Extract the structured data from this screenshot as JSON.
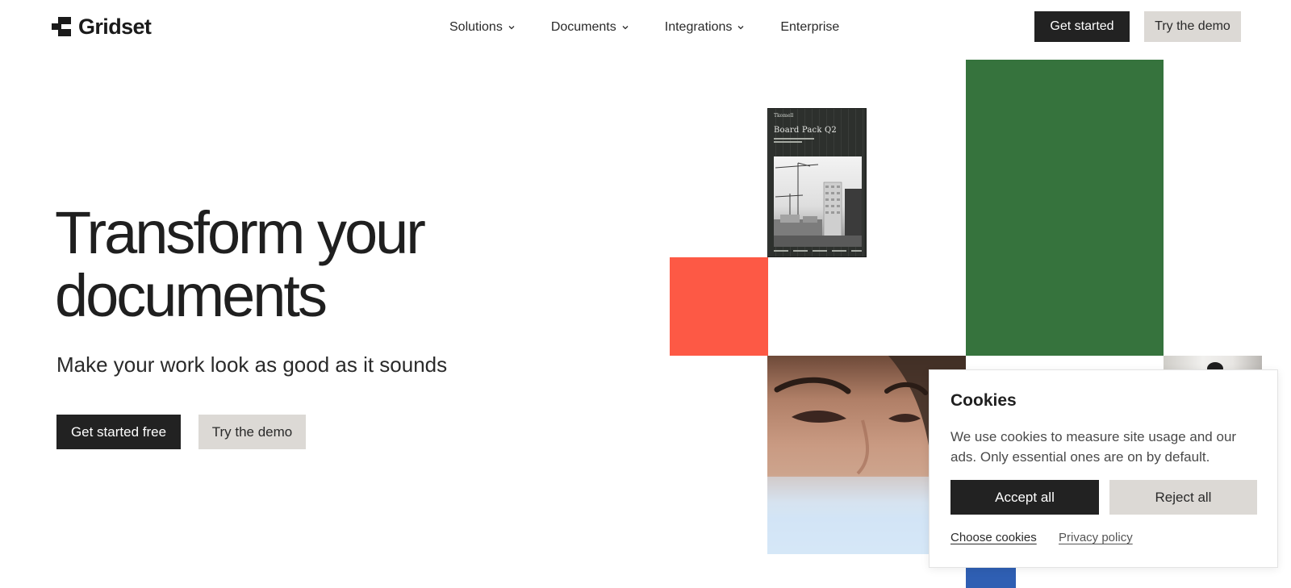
{
  "colors": {
    "dark": "#222222",
    "light_button": "#dcd9d5",
    "tile_green": "#36733d",
    "tile_red": "#fd5945",
    "tile_blue": "#2f5fb3"
  },
  "header": {
    "logo_text": "Gridset",
    "logo_icon": "gridset-logo-icon",
    "nav": [
      {
        "label": "Solutions",
        "has_dropdown": true
      },
      {
        "label": "Documents",
        "has_dropdown": true
      },
      {
        "label": "Integrations",
        "has_dropdown": true
      },
      {
        "label": "Enterprise",
        "has_dropdown": false
      }
    ],
    "get_started_label": "Get started",
    "demo_label": "Try the demo"
  },
  "hero": {
    "title_line1": "Transform your",
    "title_line2": "documents",
    "subtitle": "Make your work look as good as it sounds",
    "primary_cta": "Get started free",
    "secondary_cta": "Try the demo"
  },
  "collage": {
    "doc_card": {
      "brand": "Tkomell",
      "title": "Board Pack Q2"
    }
  },
  "cookie_banner": {
    "title": "Cookies",
    "text": "We use cookies to measure site usage and our ads. Only essential ones are on by default.",
    "accept_label": "Accept all",
    "reject_label": "Reject all",
    "choose_label": "Choose cookies",
    "privacy_label": "Privacy policy"
  }
}
